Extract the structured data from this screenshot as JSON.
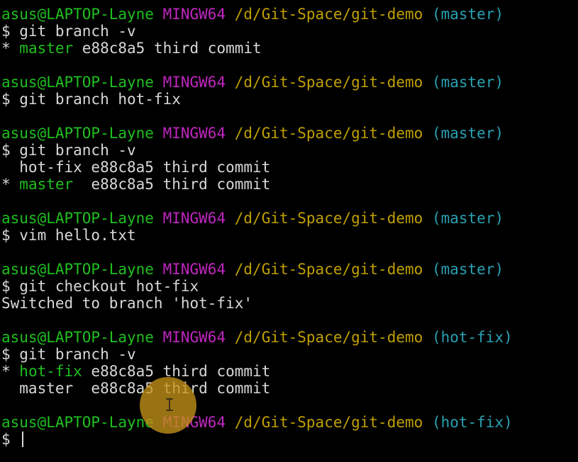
{
  "terminal": {
    "prompt": {
      "user_host": "asus@LAPTOP-Layne",
      "system": "MINGW64",
      "path": "/d/Git-Space/git-demo"
    },
    "lines": [
      {
        "type": "prompt",
        "branch": "(master)"
      },
      {
        "type": "command",
        "text": "$ git branch -v"
      },
      {
        "type": "branch-current",
        "marker": "* ",
        "name": "master",
        "rest": " e88c8a5 third commit"
      },
      {
        "type": "blank"
      },
      {
        "type": "prompt",
        "branch": "(master)"
      },
      {
        "type": "command",
        "text": "$ git branch hot-fix"
      },
      {
        "type": "blank"
      },
      {
        "type": "prompt",
        "branch": "(master)"
      },
      {
        "type": "command",
        "text": "$ git branch -v"
      },
      {
        "type": "output",
        "text": "  hot-fix e88c8a5 third commit"
      },
      {
        "type": "branch-current",
        "marker": "* ",
        "name": "master",
        "rest": "  e88c8a5 third commit"
      },
      {
        "type": "blank"
      },
      {
        "type": "prompt",
        "branch": "(master)"
      },
      {
        "type": "command",
        "text": "$ vim hello.txt"
      },
      {
        "type": "blank"
      },
      {
        "type": "prompt",
        "branch": "(master)"
      },
      {
        "type": "command",
        "text": "$ git checkout hot-fix"
      },
      {
        "type": "output",
        "text": "Switched to branch 'hot-fix'"
      },
      {
        "type": "blank"
      },
      {
        "type": "prompt",
        "branch": "(hot-fix)"
      },
      {
        "type": "command",
        "text": "$ git branch -v"
      },
      {
        "type": "branch-current",
        "marker": "* ",
        "name": "hot-fix",
        "rest": " e88c8a5 third commit"
      },
      {
        "type": "output",
        "text": "  master  e88c8a5 third commit"
      },
      {
        "type": "blank"
      },
      {
        "type": "prompt",
        "branch": "(hot-fix)"
      },
      {
        "type": "input",
        "text": "$ "
      }
    ]
  },
  "colors": {
    "background": "#000000",
    "text": "#d8d8d8",
    "user_host": "#1fbf1f",
    "system": "#c026c0",
    "path": "#c0a000",
    "branch": "#2aa1b3",
    "click_highlight": "#c49218"
  },
  "icons": {
    "cursor": "text-cursor-icon",
    "pointer": "ibeam-icon"
  }
}
